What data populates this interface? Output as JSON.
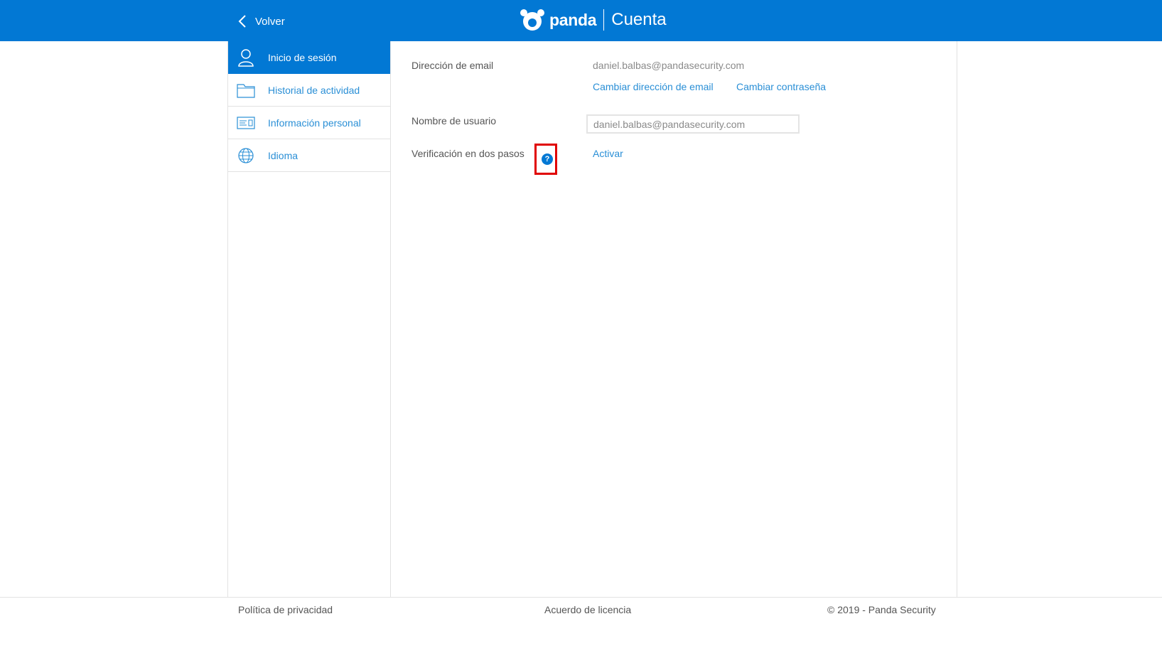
{
  "header": {
    "back_label": "Volver",
    "brand_name": "panda",
    "app_title": "Cuenta",
    "background_color": "#0278d4"
  },
  "sidebar": {
    "items": [
      {
        "label": "Inicio de sesión",
        "icon": "user-icon",
        "active": true
      },
      {
        "label": "Historial de actividad",
        "icon": "folder-icon",
        "active": false
      },
      {
        "label": "Información personal",
        "icon": "id-card-icon",
        "active": false
      },
      {
        "label": "Idioma",
        "icon": "globe-icon",
        "active": false
      }
    ]
  },
  "main": {
    "email": {
      "label": "Dirección de email",
      "value": "daniel.balbas@pandasecurity.com",
      "change_email_link": "Cambiar dirección de email",
      "change_password_link": "Cambiar contraseña"
    },
    "username": {
      "label": "Nombre de usuario",
      "value": "daniel.balbas@pandasecurity.com"
    },
    "two_step": {
      "label": "Verificación en dos pasos",
      "help_icon": "?",
      "action_link": "Activar"
    }
  },
  "footer": {
    "privacy": "Política de privacidad",
    "license": "Acuerdo de licencia",
    "copyright": "© 2019 - Panda Security"
  },
  "colors": {
    "accent": "#0278d4",
    "link": "#2a8fd6",
    "highlight_box": "#e00000"
  }
}
